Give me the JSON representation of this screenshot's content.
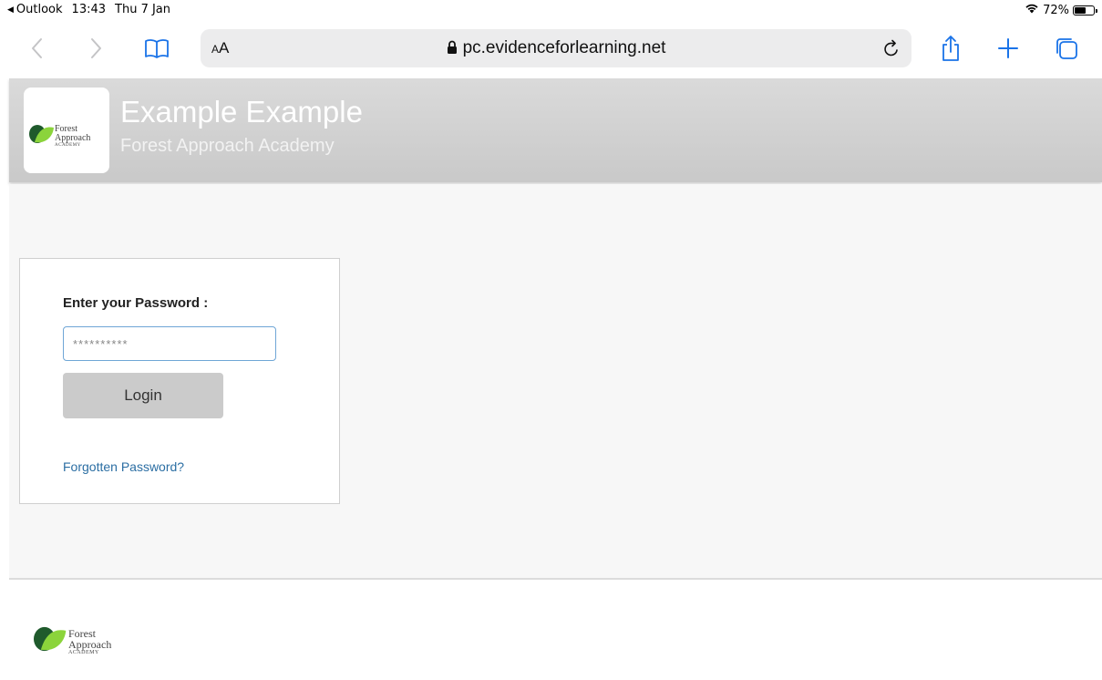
{
  "status_bar": {
    "back_app": "Outlook",
    "time": "13:43",
    "date": "Thu 7 Jan",
    "battery_percent": "72%",
    "battery_level": 0.72
  },
  "browser": {
    "text_size_label_small": "A",
    "text_size_label_large": "A",
    "url": "pc.evidenceforlearning.net"
  },
  "header": {
    "title": "Example Example",
    "subtitle": "Forest Approach Academy"
  },
  "logo": {
    "line1": "Forest",
    "line2": "Approach",
    "line3": "ACADEMY"
  },
  "login": {
    "label": "Enter your Password :",
    "password_value": "**********",
    "button_label": "Login",
    "forgot_link": "Forgotten Password?"
  },
  "colors": {
    "accent_link": "#2b6ea3",
    "header_bg": "#cfcfcf",
    "logo_dark_green": "#1f5a2c",
    "logo_light_green": "#8bd43b",
    "input_border": "#6fa6d6"
  },
  "icons": {
    "back": "chevron-left-icon",
    "forward": "chevron-right-icon",
    "bookmarks": "book-icon",
    "lock": "lock-icon",
    "reload": "reload-icon",
    "share": "share-icon",
    "new_tab": "plus-icon",
    "tabs": "tabs-icon",
    "wifi": "wifi-icon",
    "battery": "battery-icon"
  }
}
